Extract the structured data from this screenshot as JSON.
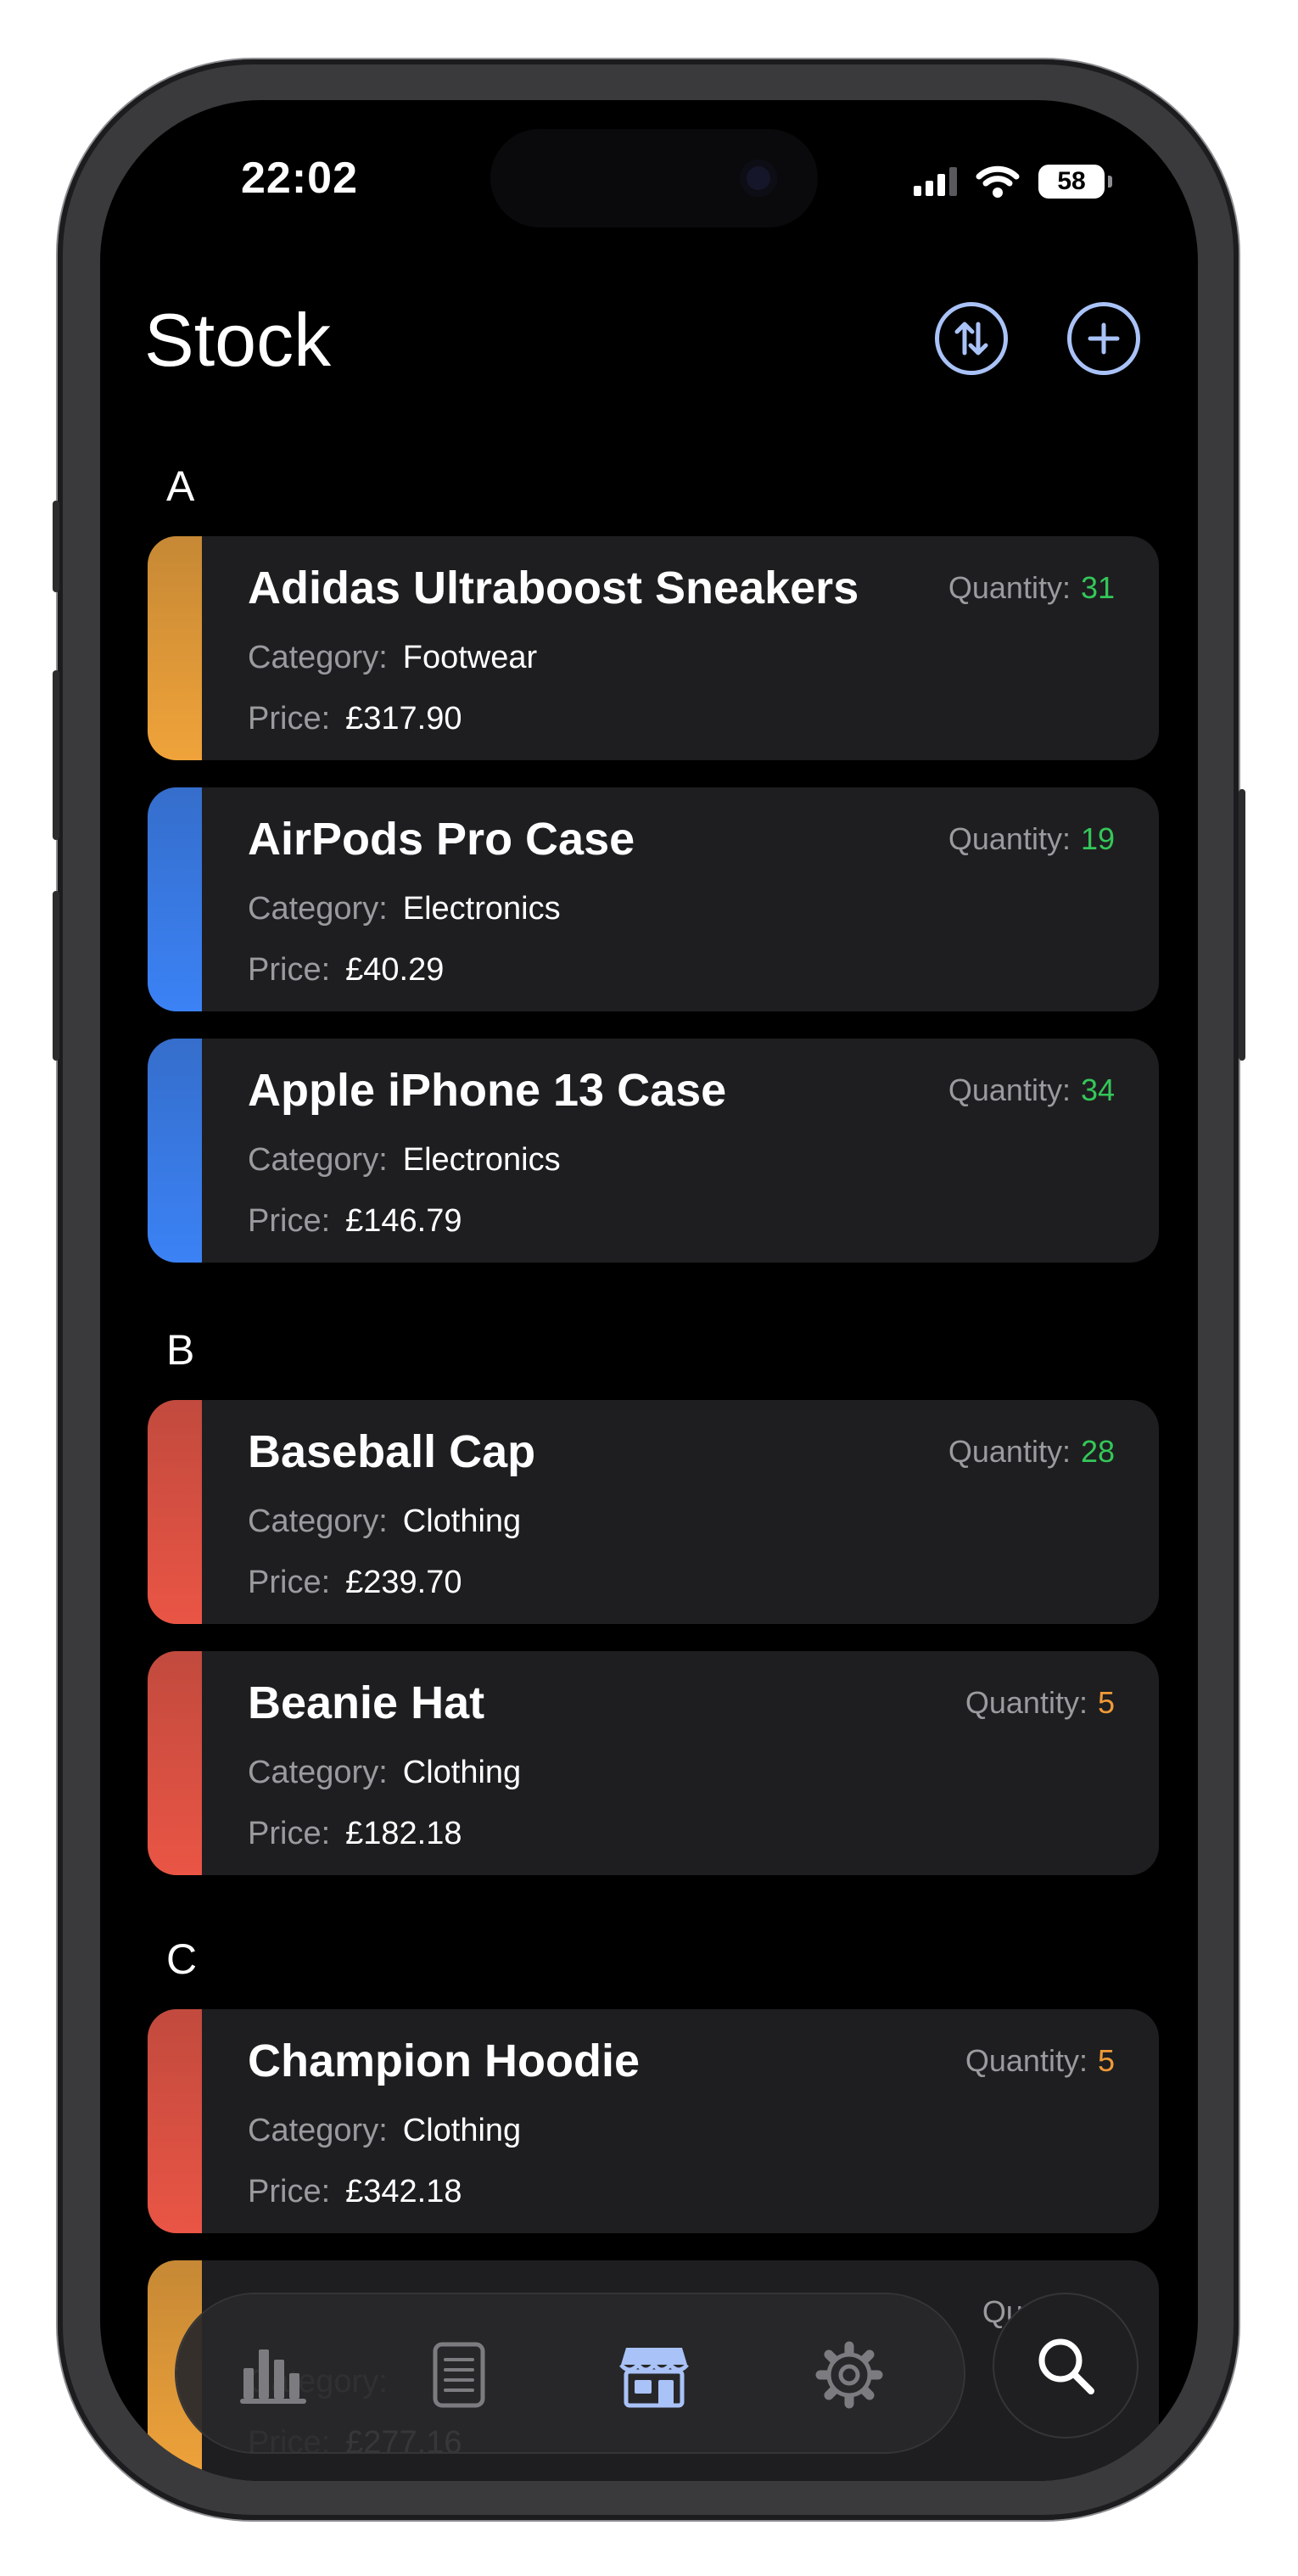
{
  "status": {
    "time": "22:02",
    "battery": "58"
  },
  "header": {
    "title": "Stock",
    "sort_icon": "sort-arrows-icon",
    "add_icon": "plus-circle-icon"
  },
  "labels": {
    "quantity": "Quantity:",
    "category": "Category:",
    "price": "Price:"
  },
  "sections": [
    {
      "letter": "A",
      "items": [
        {
          "name": "Adidas Ultraboost Sneakers",
          "quantity": "31",
          "category": "Footwear",
          "price": "£317.90",
          "accent": "#f0a33a",
          "qty_color": "#34c759"
        },
        {
          "name": "AirPods Pro Case",
          "quantity": "19",
          "category": "Electronics",
          "price": "£40.29",
          "accent": "#3b82f6",
          "qty_color": "#34c759"
        },
        {
          "name": "Apple iPhone 13 Case",
          "quantity": "34",
          "category": "Electronics",
          "price": "£146.79",
          "accent": "#3b82f6",
          "qty_color": "#34c759"
        }
      ]
    },
    {
      "letter": "B",
      "items": [
        {
          "name": "Baseball Cap",
          "quantity": "28",
          "category": "Clothing",
          "price": "£239.70",
          "accent": "#ea5545",
          "qty_color": "#34c759"
        },
        {
          "name": "Beanie Hat",
          "quantity": "5",
          "category": "Clothing",
          "price": "£182.18",
          "accent": "#ea5545",
          "qty_color": "#f09a37"
        }
      ]
    },
    {
      "letter": "C",
      "items": [
        {
          "name": "Champion Hoodie",
          "quantity": "5",
          "category": "Clothing",
          "price": "£342.18",
          "accent": "#ea5545",
          "qty_color": "#f09a37"
        },
        {
          "name": "",
          "quantity": "",
          "category": "",
          "price": "£277.16",
          "accent": "#f0a33a",
          "qty_color": "#f0c030"
        }
      ]
    }
  ],
  "tabbar": {
    "tabs": [
      {
        "icon": "bar-chart-icon",
        "active": false
      },
      {
        "icon": "list-document-icon",
        "active": false
      },
      {
        "icon": "storefront-icon",
        "active": true
      }
    ],
    "settings_icon": "gear-icon",
    "search_icon": "search-icon"
  },
  "colors": {
    "active_tab": "#a9c2f7",
    "inactive_tab": "#7c7c80",
    "header_button": "#a9c2f7"
  }
}
